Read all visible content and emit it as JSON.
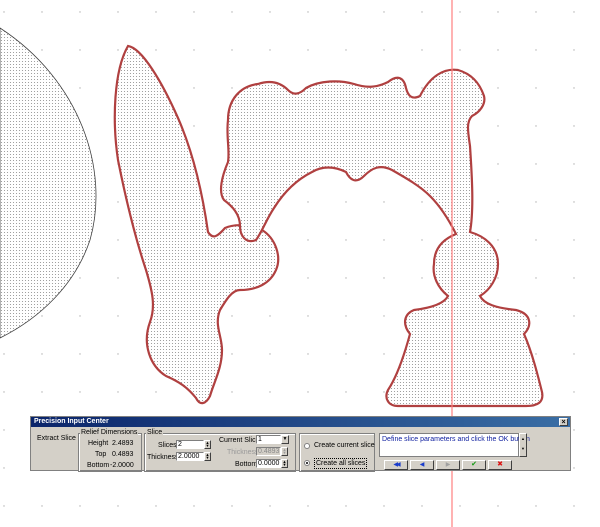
{
  "panel": {
    "title": "Precision Input Center",
    "close_label": "×",
    "extract_label": "Extract Slice",
    "relief": {
      "title": "Relief Dimensions",
      "height_label": "Height",
      "height_value": "2.4893",
      "top_label": "Top",
      "top_value": "0.4893",
      "bottom_label": "Bottom",
      "bottom_value": "-2.0000"
    },
    "slice": {
      "title": "Slice",
      "slices_label": "Slices",
      "slices_value": "2",
      "thickness_label": "Thickness",
      "thickness_value": "2.0000",
      "current_label": "Current Slice",
      "current_value": "1",
      "cur_thickness_label": "Thickness",
      "cur_thickness_value": "0.4893",
      "bottom_label": "Bottom",
      "bottom_value": "0.0000"
    },
    "options": {
      "create_current": "Create current slice",
      "create_all": "Create all slices",
      "selected": "create_all"
    },
    "message": "Define slice parameters and click the OK button",
    "buttons": {
      "first": "◀◀",
      "prev": "◀",
      "next": "▶",
      "ok": "✔",
      "cancel": "✖"
    },
    "colors": {
      "first": "#1a3ccc",
      "prev": "#1a3ccc",
      "next": "#a0a0a0",
      "ok": "#119911",
      "cancel": "#dd1111"
    }
  },
  "canvas": {
    "outline_color": "#b04040",
    "guide_color": "#ff8080",
    "dot_color": "#8a8a8a"
  }
}
